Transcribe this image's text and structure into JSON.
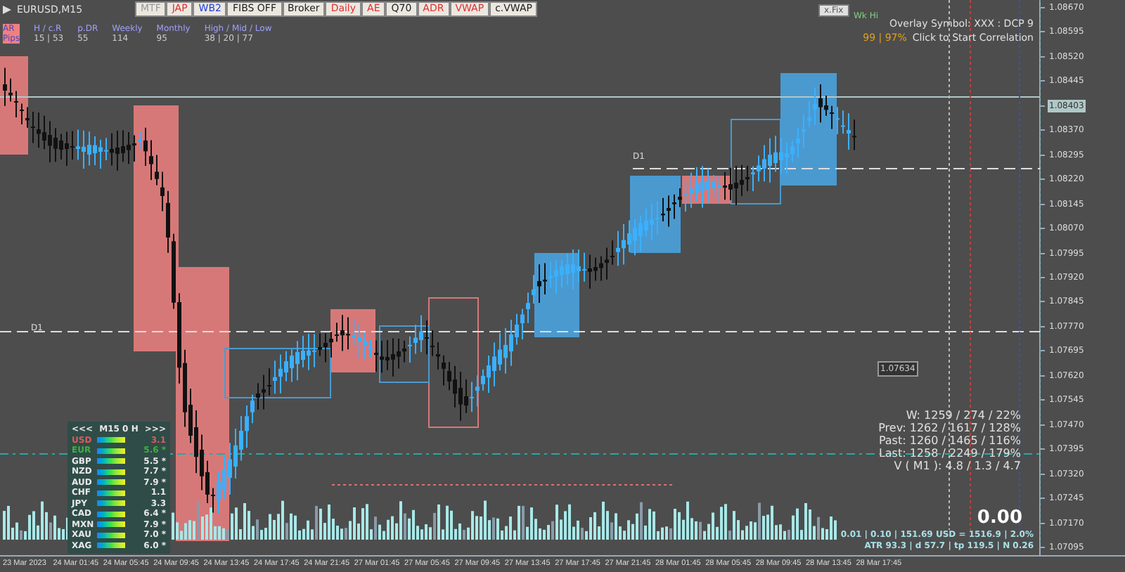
{
  "chart_title": "EURUSD,M15",
  "toolbar": [
    {
      "label": "MTF",
      "color": "#9a9a9a"
    },
    {
      "label": "JAP",
      "color": "#e03030"
    },
    {
      "label": "WB2",
      "color": "#2040e0"
    },
    {
      "label": "FIBS OFF",
      "color": "#202020"
    },
    {
      "label": "Broker",
      "color": "#202020"
    },
    {
      "label": "Daily",
      "color": "#e03030"
    },
    {
      "label": "AE",
      "color": "#e03030"
    },
    {
      "label": "Q70",
      "color": "#202020"
    },
    {
      "label": "ADR",
      "color": "#e03030"
    },
    {
      "label": "VWAP",
      "color": "#e03030"
    },
    {
      "label": "c.VWAP",
      "color": "#202020"
    }
  ],
  "fix_button": "x.Fix",
  "week_high_label": "Wk Hi",
  "range_info": {
    "row_label": "AR Pips",
    "columns": [
      {
        "heading": "H / c.R",
        "value": "15 | 53"
      },
      {
        "heading": "p.DR",
        "value": "55"
      },
      {
        "heading": "Weekly",
        "value": "114"
      },
      {
        "heading": "Monthly",
        "value": "95"
      },
      {
        "heading": "High / Mid / Low",
        "value": "38 | 20 | 77"
      }
    ]
  },
  "correlation": {
    "overlay": "Overlay Symbol: XXX : DCP 9",
    "score": "99 | 97%",
    "action": "Click to Start Correlation"
  },
  "day_labels": [
    "D1",
    "D1"
  ],
  "price_tag": "1.07634",
  "price_axis": [
    {
      "label": "1.08670",
      "current": false
    },
    {
      "label": "1.08595",
      "current": false
    },
    {
      "label": "1.08520",
      "current": false
    },
    {
      "label": "1.08445",
      "current": false
    },
    {
      "label": "1.08403",
      "current": true
    },
    {
      "label": "1.08370",
      "current": false
    },
    {
      "label": "1.08295",
      "current": false
    },
    {
      "label": "1.08220",
      "current": false
    },
    {
      "label": "1.08145",
      "current": false
    },
    {
      "label": "1.08070",
      "current": false
    },
    {
      "label": "1.07995",
      "current": false
    },
    {
      "label": "1.07920",
      "current": false
    },
    {
      "label": "1.07845",
      "current": false
    },
    {
      "label": "1.07770",
      "current": false
    },
    {
      "label": "1.07695",
      "current": false
    },
    {
      "label": "1.07620",
      "current": false
    },
    {
      "label": "1.07545",
      "current": false
    },
    {
      "label": "1.07470",
      "current": false
    },
    {
      "label": "1.07395",
      "current": false
    },
    {
      "label": "1.07320",
      "current": false
    },
    {
      "label": "1.07245",
      "current": false
    },
    {
      "label": "1.07170",
      "current": false
    },
    {
      "label": "1.07095",
      "current": false
    }
  ],
  "time_axis": [
    "23 Mar 2023",
    "24 Mar 01:45",
    "24 Mar 05:45",
    "24 Mar 09:45",
    "24 Mar 13:45",
    "24 Mar 17:45",
    "24 Mar 21:45",
    "27 Mar 01:45",
    "27 Mar 05:45",
    "27 Mar 09:45",
    "27 Mar 13:45",
    "27 Mar 17:45",
    "27 Mar 21:45",
    "28 Mar 01:45",
    "28 Mar 05:45",
    "28 Mar 09:45",
    "28 Mar 13:45",
    "28 Mar 17:45"
  ],
  "strength_panel": {
    "prev": "<<<",
    "title": "M15 0 H",
    "next": ">>>",
    "currencies": [
      {
        "name": "USD",
        "value": "3.1",
        "color": "#e05a5a"
      },
      {
        "name": "EUR",
        "value": "5.6 *",
        "color": "#3cb43c"
      },
      {
        "name": "GBP",
        "value": "5.5 *",
        "color": "#e8e8e8"
      },
      {
        "name": "NZD",
        "value": "7.7 *",
        "color": "#e8e8e8"
      },
      {
        "name": "AUD",
        "value": "7.9 *",
        "color": "#e8e8e8"
      },
      {
        "name": "CHF",
        "value": "1.1",
        "color": "#e8e8e8"
      },
      {
        "name": "JPY",
        "value": "3.3",
        "color": "#e8e8e8"
      },
      {
        "name": "CAD",
        "value": "6.4 *",
        "color": "#e8e8e8"
      },
      {
        "name": "MXN",
        "value": "7.9 *",
        "color": "#e8e8e8"
      },
      {
        "name": "XAU",
        "value": "7.0 *",
        "color": "#e8e8e8"
      },
      {
        "name": "XAG",
        "value": "6.0 *",
        "color": "#e8e8e8"
      }
    ]
  },
  "stats": [
    "W: 1259 / 274 / 22%",
    "Prev: 1262 / 1617 / 128%",
    "Past: 1260 / 1465 / 116%",
    "Last: 1258 / 2249 / 179%",
    "V ( M1 ): 4.8 / 1.3 / 4.7"
  ],
  "profit": "0.00",
  "risk_line": "0.01 | 0.10 | 151.69 USD = 1516.9 | 2.0%",
  "atr_line": "ATR 93.3 | d 57.7 | tp 119.5 | N 0.26"
}
